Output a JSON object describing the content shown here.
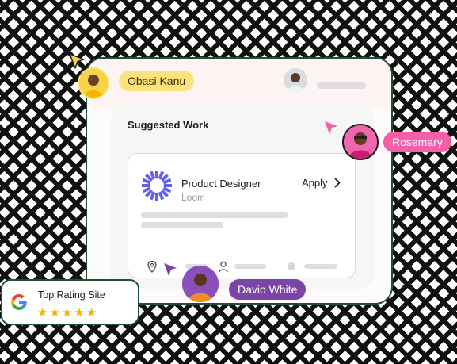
{
  "suggested": {
    "title": "Suggested Work",
    "job": {
      "title": "Product Designer",
      "company": "Loom",
      "apply_label": "Apply"
    }
  },
  "collaborators": [
    {
      "name": "Obasi Kanu",
      "color": "#fde27a"
    },
    {
      "name": "Rosemary",
      "color": "#f45fa7"
    },
    {
      "name": "Davio White",
      "color": "#7b45a7"
    }
  ],
  "badge": {
    "title": "Top Rating Site",
    "rating": 5,
    "stars": [
      "★",
      "★",
      "★",
      "★",
      "★"
    ]
  },
  "colors": {
    "accent_green": "#1f5132",
    "loom_purple": "#625df5"
  }
}
